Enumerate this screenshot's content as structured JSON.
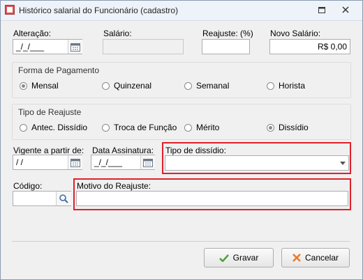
{
  "window": {
    "title": "Histórico salarial do Funcionário  (cadastro)"
  },
  "fields": {
    "alteracao": {
      "label": "Alteração:",
      "value": "_/_/___"
    },
    "salario": {
      "label": "Salário:",
      "value": ""
    },
    "reajuste": {
      "label": "Reajuste: (%)",
      "value": ""
    },
    "novo_salario": {
      "label": "Novo Salário:",
      "value": "R$ 0,00"
    },
    "vigente": {
      "label": "Vigente a partir de:",
      "value": "/ /"
    },
    "data_assinatura": {
      "label": "Data Assinatura:",
      "value": "_/_/___"
    },
    "tipo_dissidio": {
      "label": "Tipo de dissídio:",
      "value": ""
    },
    "codigo": {
      "label": "Código:",
      "value": ""
    },
    "motivo": {
      "label": "Motivo do Reajuste:",
      "value": ""
    }
  },
  "forma_pagamento": {
    "title": "Forma de Pagamento",
    "options": [
      "Mensal",
      "Quinzenal",
      "Semanal",
      "Horista"
    ],
    "selected": "Mensal"
  },
  "tipo_reajuste": {
    "title": "Tipo de Reajuste",
    "options": [
      "Antec. Dissídio",
      "Troca de Função",
      "Mérito",
      "Dissídio"
    ],
    "selected": "Dissídio"
  },
  "buttons": {
    "gravar": "Gravar",
    "cancelar": "Cancelar"
  },
  "colors": {
    "highlight": "#e0202a",
    "ok_green": "#4ca23a",
    "cancel_orange": "#e8792a"
  }
}
